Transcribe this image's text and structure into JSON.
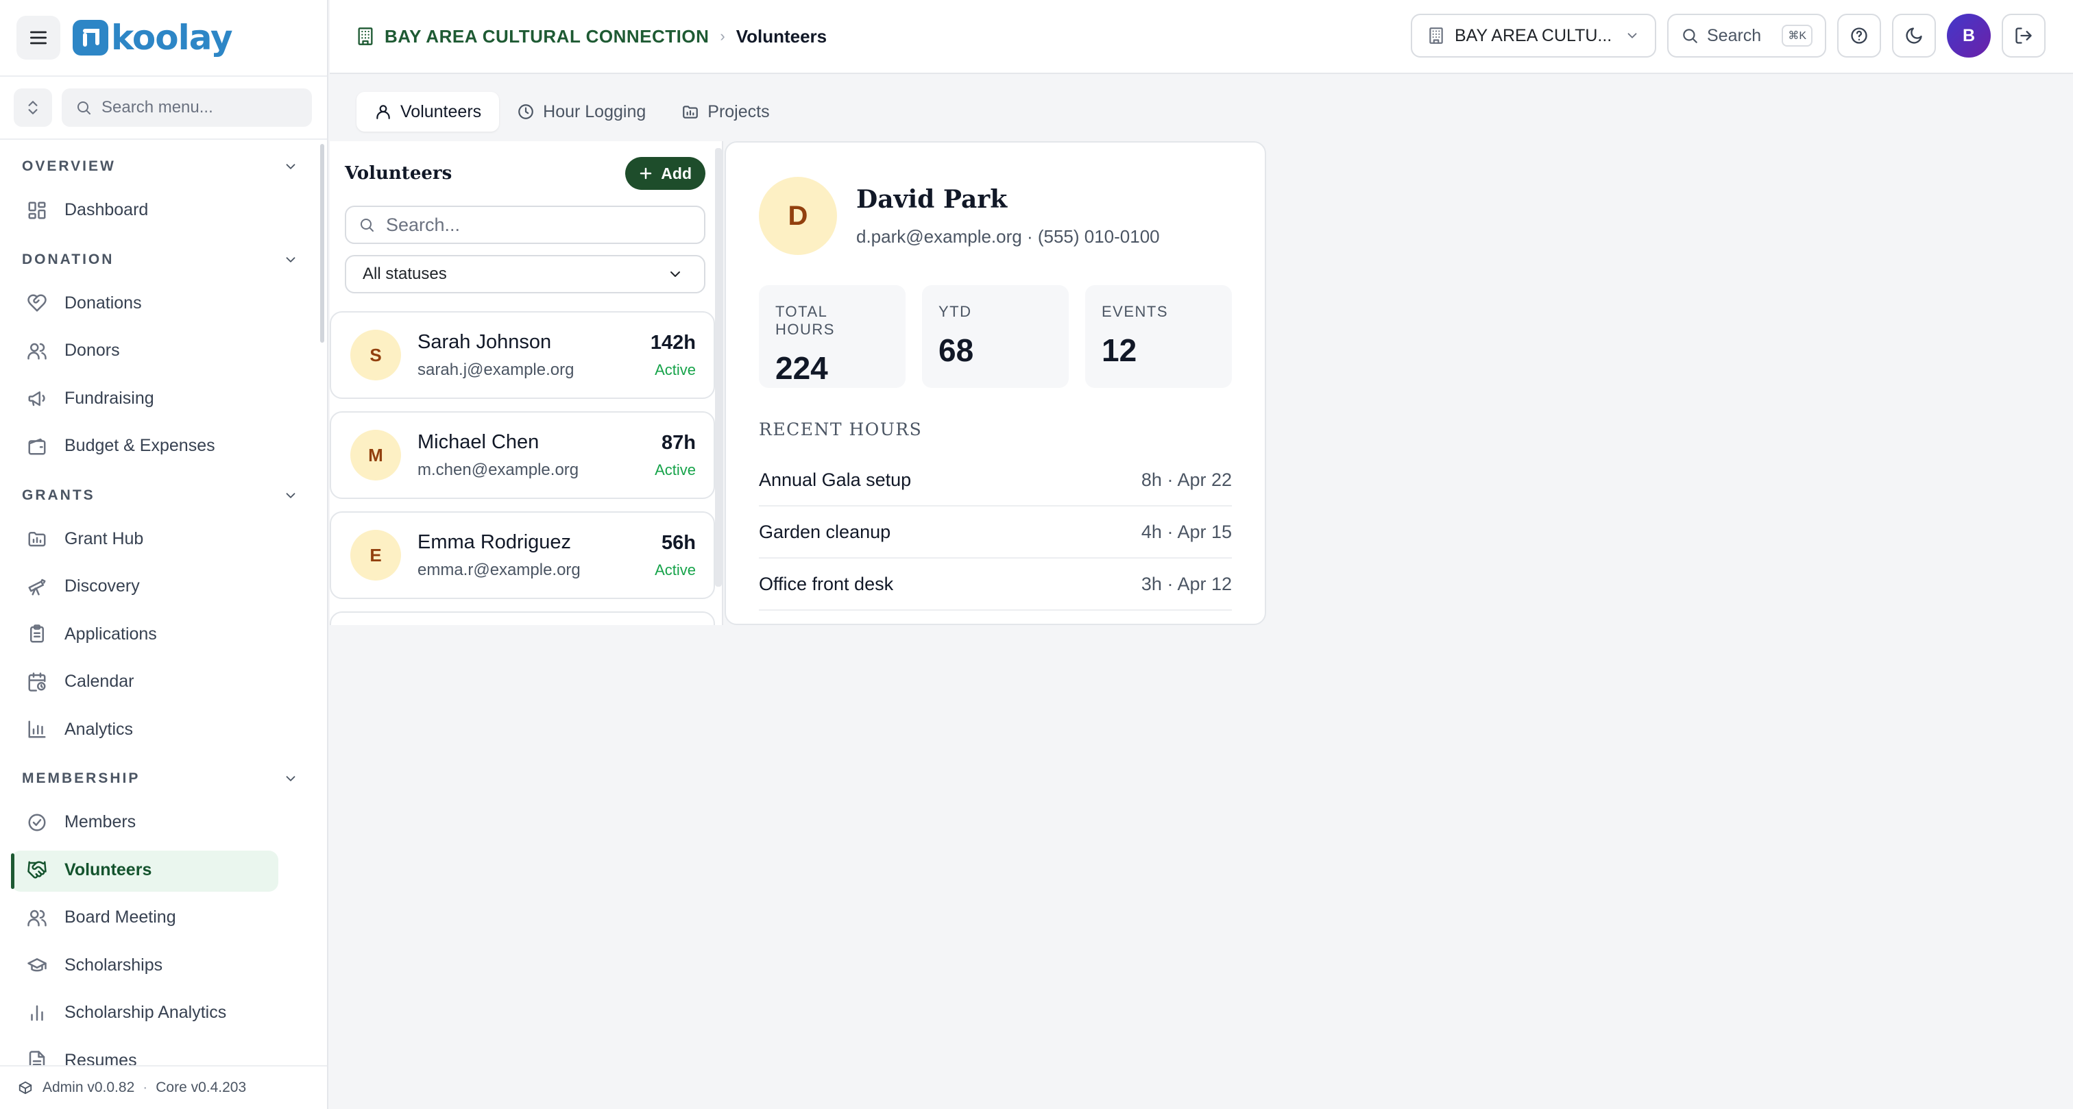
{
  "app": {
    "brand": "koolay"
  },
  "sidebar": {
    "search_placeholder": "Search menu...",
    "sections": [
      {
        "title": "OVERVIEW",
        "items": [
          {
            "label": "Dashboard",
            "icon": "grid-icon"
          }
        ]
      },
      {
        "title": "DONATION",
        "items": [
          {
            "label": "Donations",
            "icon": "heart-hand-icon"
          },
          {
            "label": "Donors",
            "icon": "users-icon"
          },
          {
            "label": "Fundraising",
            "icon": "megaphone-icon"
          },
          {
            "label": "Budget & Expenses",
            "icon": "wallet-icon"
          }
        ]
      },
      {
        "title": "GRANTS",
        "items": [
          {
            "label": "Grant Hub",
            "icon": "folder-icon"
          },
          {
            "label": "Discovery",
            "icon": "telescope-icon"
          },
          {
            "label": "Applications",
            "icon": "clipboard-icon"
          },
          {
            "label": "Calendar",
            "icon": "calendar-clock-icon"
          },
          {
            "label": "Analytics",
            "icon": "bar-chart-icon"
          }
        ]
      },
      {
        "title": "MEMBERSHIP",
        "items": [
          {
            "label": "Members",
            "icon": "check-circle-icon"
          },
          {
            "label": "Volunteers",
            "icon": "handshake-icon",
            "active": true
          },
          {
            "label": "Board Meeting",
            "icon": "users-icon"
          },
          {
            "label": "Scholarships",
            "icon": "graduation-cap-icon"
          },
          {
            "label": "Scholarship Analytics",
            "icon": "bar-chart-icon"
          },
          {
            "label": "Resumes",
            "icon": "document-icon"
          }
        ]
      }
    ],
    "footer": {
      "admin_version": "Admin v0.0.82",
      "separator": "·",
      "core_version": "Core v0.4.203"
    }
  },
  "header": {
    "org": "BAY AREA CULTURAL CONNECTION",
    "crumb_sep": "›",
    "page": "Volunteers",
    "org_selector": "BAY AREA CULTU...",
    "search_label": "Search",
    "search_shortcut": "⌘K",
    "avatar_initial": "B"
  },
  "tabs": [
    {
      "label": "Volunteers",
      "icon": "user-icon",
      "active": true
    },
    {
      "label": "Hour Logging",
      "icon": "clock-icon"
    },
    {
      "label": "Projects",
      "icon": "folder-icon"
    }
  ],
  "volunteer_list": {
    "title": "Volunteers",
    "add_label": "Add",
    "search_placeholder": "Search...",
    "filter_value": "All statuses",
    "items": [
      {
        "initial": "S",
        "name": "Sarah Johnson",
        "email": "sarah.j@example.org",
        "hours": "142h",
        "status": "Active"
      },
      {
        "initial": "M",
        "name": "Michael Chen",
        "email": "m.chen@example.org",
        "hours": "87h",
        "status": "Active"
      },
      {
        "initial": "E",
        "name": "Emma Rodriguez",
        "email": "emma.r@example.org",
        "hours": "56h",
        "status": "Active"
      }
    ]
  },
  "detail": {
    "initial": "D",
    "name": "David Park",
    "contact": "d.park@example.org · (555) 010-0100",
    "stats": [
      {
        "label": "TOTAL HOURS",
        "value": "224"
      },
      {
        "label": "YTD",
        "value": "68"
      },
      {
        "label": "EVENTS",
        "value": "12"
      }
    ],
    "recent_title": "RECENT HOURS",
    "recent": [
      {
        "name": "Annual Gala setup",
        "value": "8h · Apr 22"
      },
      {
        "name": "Garden cleanup",
        "value": "4h · Apr 15"
      },
      {
        "name": "Office front desk",
        "value": "3h · Apr 12"
      }
    ]
  },
  "colors": {
    "accent_green": "#1e4d2b",
    "brand_blue": "#2d86c6",
    "active_bg": "#eaf6ee",
    "status_active": "#16a34a",
    "avatar_bg": "#fdf0c4"
  }
}
